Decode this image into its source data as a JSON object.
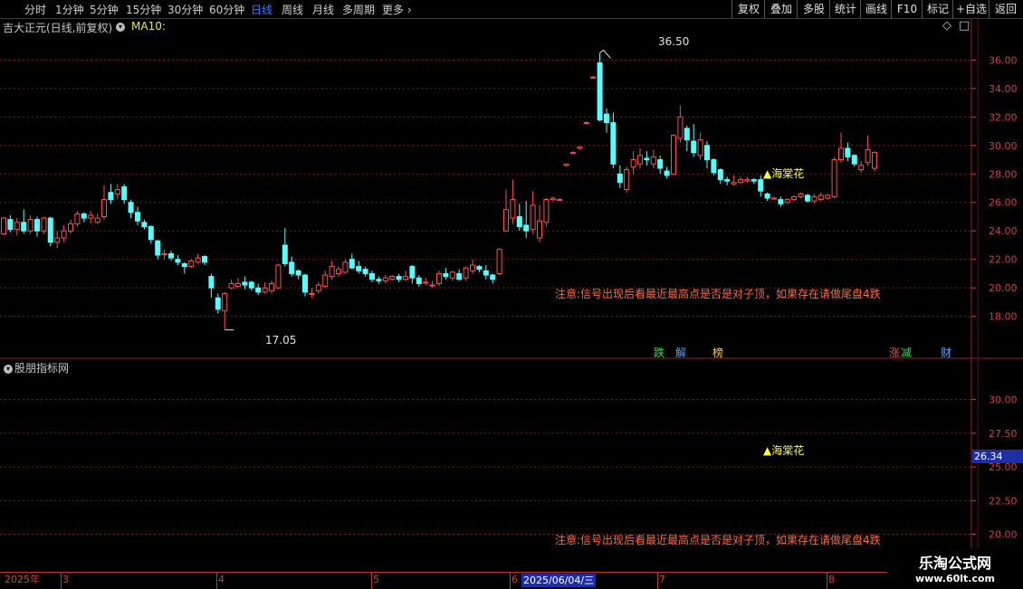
{
  "toolbar": {
    "timeframes": [
      "分时",
      "1分钟",
      "5分钟",
      "15分钟",
      "30分钟",
      "60分钟",
      "日线",
      "周线",
      "月线",
      "多周期",
      "更多"
    ],
    "active_index": 6,
    "more_chevron": "›",
    "right_buttons": [
      "复权",
      "叠加",
      "多股",
      "统计",
      "画线",
      "F10",
      "标记",
      "+自选",
      "返回"
    ]
  },
  "chart_header": {
    "stock_name": "吉大正元(日线,前复权)",
    "ma_label": "MA10:"
  },
  "indicator_panel": {
    "title": "股朋指标网"
  },
  "chart_data": [
    {
      "type": "candlestick",
      "y_ticks": [
        18,
        20,
        22,
        24,
        26,
        28,
        30,
        32,
        34,
        36
      ],
      "y_tick_labels": [
        "18.00",
        "20.00",
        "22.00",
        "24.00",
        "26.00",
        "28.00",
        "30.00",
        "32.00",
        "34.00",
        "36.00"
      ],
      "ylim": [
        16.2,
        37.8
      ],
      "grid": true,
      "candles": [
        [
          23.8,
          24.9,
          23.7,
          25.0
        ],
        [
          24.8,
          24.1,
          23.9,
          25.1
        ],
        [
          24.1,
          24.6,
          23.7,
          24.9
        ],
        [
          24.6,
          24.0,
          23.8,
          25.5
        ],
        [
          24.0,
          24.8,
          23.8,
          25.1
        ],
        [
          24.8,
          24.0,
          23.6,
          25.0
        ],
        [
          24.0,
          24.9,
          23.8,
          25.0
        ],
        [
          24.9,
          23.2,
          22.9,
          25.0
        ],
        [
          23.2,
          23.5,
          22.8,
          24.0
        ],
        [
          23.5,
          24.0,
          23.2,
          24.4
        ],
        [
          24.0,
          24.5,
          23.8,
          24.8
        ],
        [
          24.5,
          25.2,
          24.3,
          25.4
        ],
        [
          25.2,
          24.9,
          24.6,
          25.3
        ],
        [
          24.9,
          25.1,
          24.5,
          25.4
        ],
        [
          24.6,
          24.9,
          24.5,
          25.2
        ],
        [
          25.0,
          26.2,
          24.8,
          27.2
        ],
        [
          26.7,
          26.2,
          25.9,
          27.3
        ],
        [
          26.6,
          26.9,
          26.2,
          27.3
        ],
        [
          27.1,
          26.2,
          25.9,
          27.3
        ],
        [
          26.0,
          25.3,
          24.9,
          26.2
        ],
        [
          25.3,
          24.7,
          24.4,
          25.7
        ],
        [
          24.6,
          24.3,
          24.1,
          24.8
        ],
        [
          24.3,
          23.4,
          23.1,
          24.4
        ],
        [
          23.3,
          22.3,
          22.0,
          23.4
        ],
        [
          22.4,
          22.4,
          22.0,
          22.7
        ],
        [
          22.4,
          22.1,
          21.9,
          22.6
        ],
        [
          22.0,
          21.8,
          21.6,
          22.3
        ],
        [
          21.7,
          21.5,
          21.0,
          21.8
        ],
        [
          21.5,
          21.9,
          21.4,
          22.0
        ],
        [
          21.8,
          22.1,
          21.7,
          22.4
        ],
        [
          22.2,
          21.8,
          21.6,
          22.3
        ],
        [
          20.8,
          20.0,
          19.3,
          21.0
        ],
        [
          19.3,
          18.5,
          18.2,
          19.6
        ],
        [
          18.4,
          19.6,
          17.05,
          19.7
        ],
        [
          20.0,
          20.3,
          19.9,
          20.6
        ],
        [
          20.1,
          20.3,
          20.0,
          20.7
        ],
        [
          20.4,
          20.2,
          19.9,
          20.8
        ],
        [
          20.4,
          20.0,
          19.8,
          20.5
        ],
        [
          20.0,
          19.7,
          19.5,
          20.3
        ],
        [
          19.7,
          20.0,
          19.6,
          20.4
        ],
        [
          19.8,
          20.3,
          19.6,
          20.5
        ],
        [
          20.0,
          21.6,
          19.9,
          21.7
        ],
        [
          23.0,
          21.7,
          21.5,
          24.2
        ],
        [
          21.8,
          21.0,
          20.8,
          22.2
        ],
        [
          21.2,
          20.9,
          20.6,
          21.3
        ],
        [
          20.9,
          19.7,
          19.4,
          21.0
        ],
        [
          19.6,
          19.6,
          19.3,
          20.0
        ],
        [
          19.8,
          20.2,
          19.6,
          20.4
        ],
        [
          20.1,
          20.9,
          20.0,
          21.2
        ],
        [
          20.8,
          21.5,
          20.6,
          21.9
        ],
        [
          21.0,
          21.3,
          20.8,
          21.5
        ],
        [
          21.1,
          21.8,
          21.0,
          22.0
        ],
        [
          22.0,
          21.4,
          21.3,
          22.4
        ],
        [
          21.5,
          21.2,
          21.0,
          21.9
        ],
        [
          21.3,
          21.0,
          20.8,
          21.5
        ],
        [
          21.0,
          20.6,
          20.4,
          21.2
        ],
        [
          20.6,
          20.5,
          20.3,
          20.8
        ],
        [
          20.5,
          20.7,
          20.3,
          20.9
        ],
        [
          20.6,
          20.8,
          20.5,
          20.9
        ],
        [
          20.8,
          20.6,
          20.4,
          21.0
        ],
        [
          20.6,
          20.8,
          20.5,
          21.2
        ],
        [
          21.5,
          20.7,
          20.3,
          21.6
        ],
        [
          20.7,
          20.3,
          20.1,
          20.9
        ],
        [
          20.4,
          20.4,
          20.2,
          20.7
        ],
        [
          20.2,
          20.2,
          20.0,
          20.5
        ],
        [
          20.3,
          21.0,
          20.1,
          21.2
        ],
        [
          21.0,
          20.8,
          20.6,
          21.4
        ],
        [
          20.7,
          21.1,
          20.5,
          21.2
        ],
        [
          21.0,
          20.6,
          20.5,
          21.3
        ],
        [
          20.7,
          21.4,
          20.5,
          21.5
        ],
        [
          21.2,
          21.6,
          21.0,
          22.0
        ],
        [
          21.5,
          21.3,
          21.1,
          21.6
        ],
        [
          21.2,
          20.9,
          20.6,
          21.6
        ],
        [
          20.9,
          20.6,
          20.3,
          21.0
        ],
        [
          21.0,
          22.7,
          20.9,
          22.8
        ],
        [
          24.0,
          25.5,
          23.9,
          26.9
        ],
        [
          24.9,
          26.2,
          24.5,
          27.6
        ],
        [
          25.0,
          24.3,
          24.0,
          25.9
        ],
        [
          24.4,
          24.0,
          23.5,
          26.1
        ],
        [
          24.1,
          25.8,
          23.8,
          26.8
        ],
        [
          23.5,
          24.7,
          23.2,
          25.8
        ],
        [
          24.6,
          26.2,
          24.3,
          26.3
        ],
        [
          26.2,
          26.3,
          26.1,
          26.4
        ],
        [
          26.2,
          26.2,
          26.1,
          26.3
        ],
        [
          28.6,
          28.7,
          28.5,
          28.7
        ],
        [
          29.5,
          29.5,
          29.4,
          29.6
        ],
        [
          29.8,
          29.9,
          29.7,
          29.9
        ],
        [
          31.6,
          31.6,
          31.5,
          31.7
        ],
        [
          34.8,
          34.8,
          34.7,
          34.9
        ],
        [
          35.8,
          31.8,
          31.7,
          36.5
        ],
        [
          32.2,
          31.6,
          30.9,
          32.6
        ],
        [
          31.6,
          28.7,
          28.4,
          32.3
        ],
        [
          28.0,
          27.4,
          27.0,
          28.6
        ],
        [
          26.9,
          28.3,
          26.7,
          28.5
        ],
        [
          28.5,
          29.0,
          28.0,
          29.6
        ],
        [
          28.7,
          29.3,
          28.4,
          29.8
        ],
        [
          29.1,
          29.0,
          28.6,
          29.6
        ],
        [
          28.7,
          29.2,
          28.4,
          29.7
        ],
        [
          29.0,
          28.4,
          28.0,
          29.3
        ],
        [
          28.2,
          27.9,
          27.7,
          28.5
        ],
        [
          28.0,
          30.7,
          27.9,
          30.8
        ],
        [
          30.5,
          32.0,
          30.2,
          32.8
        ],
        [
          31.2,
          30.4,
          29.6,
          31.4
        ],
        [
          30.3,
          29.5,
          29.2,
          31.5
        ],
        [
          29.3,
          30.4,
          29.0,
          30.9
        ],
        [
          30.0,
          29.0,
          28.4,
          30.3
        ],
        [
          29.0,
          28.1,
          27.9,
          29.1
        ],
        [
          28.3,
          27.6,
          27.3,
          28.4
        ],
        [
          27.6,
          27.5,
          27.2,
          27.8
        ],
        [
          27.3,
          27.4,
          27.2,
          27.9
        ],
        [
          27.4,
          27.6,
          27.3,
          27.8
        ],
        [
          27.5,
          27.6,
          27.4,
          27.8
        ],
        [
          27.6,
          27.5,
          27.3,
          27.7
        ],
        [
          27.6,
          26.8,
          26.4,
          27.9
        ],
        [
          26.6,
          26.3,
          26.1,
          26.7
        ],
        [
          26.3,
          26.3,
          26.2,
          26.4
        ],
        [
          26.2,
          25.9,
          25.7,
          26.4
        ],
        [
          26.0,
          26.2,
          25.9,
          26.3
        ],
        [
          26.2,
          26.4,
          26.1,
          26.5
        ],
        [
          26.4,
          26.6,
          26.3,
          26.7
        ],
        [
          26.5,
          26.1,
          26.0,
          26.6
        ],
        [
          26.1,
          26.4,
          25.9,
          26.6
        ],
        [
          26.2,
          26.5,
          26.1,
          26.7
        ],
        [
          26.3,
          26.5,
          26.2,
          26.6
        ],
        [
          26.4,
          29.0,
          26.3,
          29.2
        ],
        [
          29.0,
          29.8,
          28.8,
          30.9
        ],
        [
          29.8,
          29.2,
          28.9,
          30.2
        ],
        [
          29.3,
          28.7,
          28.5,
          29.4
        ],
        [
          28.3,
          28.6,
          28.1,
          28.9
        ],
        [
          28.8,
          29.7,
          28.6,
          30.7
        ],
        [
          28.4,
          29.5,
          28.2,
          29.6
        ]
      ],
      "annotations": [
        {
          "text": "36.50",
          "price": 36.5
        },
        {
          "text": "17.05",
          "price": 17.05
        },
        {
          "text": "▲海棠花"
        },
        {
          "text": "注意:信号出现后看最近最高点是否是对子顶，如果存在请做尾盘4跌"
        }
      ],
      "markers": [
        {
          "text": "跌",
          "color": "#33dd55"
        },
        {
          "text": "解",
          "color": "#4aa8ff"
        },
        {
          "text": "榜",
          "color": "#ffcc33"
        },
        {
          "text": "涨",
          "color": "#ff4444"
        },
        {
          "text": "减",
          "color": "#33dd55"
        },
        {
          "text": "财",
          "color": "#4aa8ff"
        }
      ]
    },
    {
      "type": "indicator",
      "y_ticks": [
        20,
        22.5,
        25,
        27.5,
        30
      ],
      "y_tick_labels": [
        "20.00",
        "22.50",
        "25.00",
        "27.50",
        "30.00"
      ],
      "ylim": [
        19.5,
        32.8
      ],
      "grid": true,
      "cursor_value": "26.34",
      "annotations": [
        {
          "text": "▲海棠花"
        },
        {
          "text": "注意:信号出现后看最近最高点是否是对子顶，如果存在请做尾盘4跌"
        }
      ]
    }
  ],
  "date_axis": {
    "labels": [
      "2025年",
      "3",
      "4",
      "5",
      "6",
      "7",
      "8"
    ],
    "cursor_date": "2025/06/04/三"
  },
  "watermark": {
    "title": "乐淘公式网",
    "url": "www.60lt.com"
  },
  "colors": {
    "up": "#ff4d4d",
    "down": "#54ffff",
    "grid": "#7a1818",
    "axis": "#d04040"
  }
}
